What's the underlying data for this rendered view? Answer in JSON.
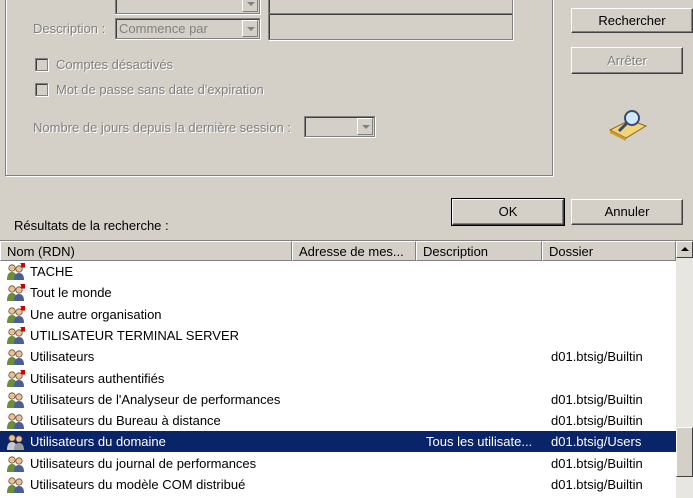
{
  "search_form": {
    "description_label": "Description :",
    "description_mode": "Commence par",
    "description_value": "",
    "name_value": "",
    "disabled_accounts_label": "Comptes désactivés",
    "no_expiry_label": "Mot de passe sans date d'expiration",
    "days_since_login_label": "Nombre de jours depuis la dernière session :",
    "days_since_login_value": ""
  },
  "buttons": {
    "search": "Rechercher",
    "stop": "Arrêter",
    "ok": "OK",
    "cancel": "Annuler"
  },
  "results_label": "Résultats de la recherche :",
  "columns": [
    "Nom (RDN)",
    "Adresse de mes...",
    "Description",
    "Dossier"
  ],
  "rows": [
    {
      "name": "TACHE",
      "description": "",
      "folder": "",
      "icon": "special-group-icon",
      "selected": false
    },
    {
      "name": "Tout le monde",
      "description": "",
      "folder": "",
      "icon": "special-group-icon",
      "selected": false
    },
    {
      "name": "Une autre organisation",
      "description": "",
      "folder": "",
      "icon": "special-group-icon",
      "selected": false
    },
    {
      "name": "UTILISATEUR TERMINAL SERVER",
      "description": "",
      "folder": "",
      "icon": "special-group-icon",
      "selected": false
    },
    {
      "name": "Utilisateurs",
      "description": "",
      "folder": "d01.btsig/Builtin",
      "icon": "group-icon",
      "selected": false
    },
    {
      "name": "Utilisateurs authentifiés",
      "description": "",
      "folder": "",
      "icon": "special-group-icon",
      "selected": false
    },
    {
      "name": "Utilisateurs de l'Analyseur de performances",
      "description": "",
      "folder": "d01.btsig/Builtin",
      "icon": "group-icon",
      "selected": false
    },
    {
      "name": "Utilisateurs du Bureau à distance",
      "description": "",
      "folder": "d01.btsig/Builtin",
      "icon": "group-icon",
      "selected": false
    },
    {
      "name": "Utilisateurs du domaine",
      "description": "Tous les utilisate...",
      "folder": "d01.btsig/Users",
      "icon": "group-icon",
      "selected": true
    },
    {
      "name": "Utilisateurs du journal de performances",
      "description": "",
      "folder": "d01.btsig/Builtin",
      "icon": "group-icon",
      "selected": false
    },
    {
      "name": "Utilisateurs du modèle COM distribué",
      "description": "",
      "folder": "d01.btsig/Builtin",
      "icon": "group-icon",
      "selected": false
    }
  ],
  "colors": {
    "selection": "#0a246a",
    "window": "#d4d0c8"
  }
}
